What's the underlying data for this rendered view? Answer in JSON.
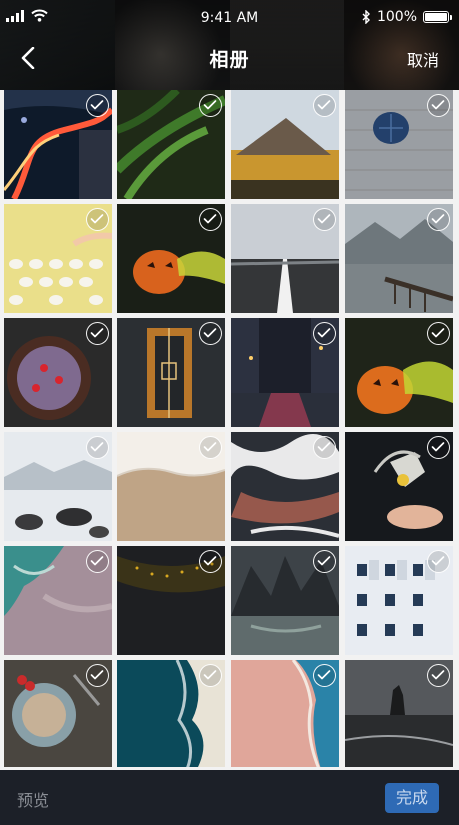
{
  "status_bar": {
    "time": "9:41 AM",
    "battery": "100%"
  },
  "nav": {
    "title": "相册",
    "cancel_label": "取消"
  },
  "footer": {
    "preview_label": "预览",
    "done_label": "完成"
  },
  "photos": [
    {
      "name": "night-highway-city"
    },
    {
      "name": "green-fern"
    },
    {
      "name": "mountain-sunset"
    },
    {
      "name": "sea-urchin-on-tiles"
    },
    {
      "name": "yellow-eggs-hand"
    },
    {
      "name": "pumpkin-smoke"
    },
    {
      "name": "road-fog"
    },
    {
      "name": "lake-pier-mountains"
    },
    {
      "name": "chocolate-cake"
    },
    {
      "name": "basketball-court-aerial"
    },
    {
      "name": "rainy-city-street"
    },
    {
      "name": "pumpkin-smoke-2"
    },
    {
      "name": "snowy-rocks"
    },
    {
      "name": "paper-texture"
    },
    {
      "name": "red-terrain-aerial"
    },
    {
      "name": "bird-on-hand"
    },
    {
      "name": "teal-shore-aerial"
    },
    {
      "name": "dark-forest-aerial"
    },
    {
      "name": "lake-valley-mountains"
    },
    {
      "name": "building-windows"
    },
    {
      "name": "food-table"
    },
    {
      "name": "ocean-waves-aerial"
    },
    {
      "name": "pink-beach-aerial"
    },
    {
      "name": "sea-stack-coast"
    }
  ]
}
